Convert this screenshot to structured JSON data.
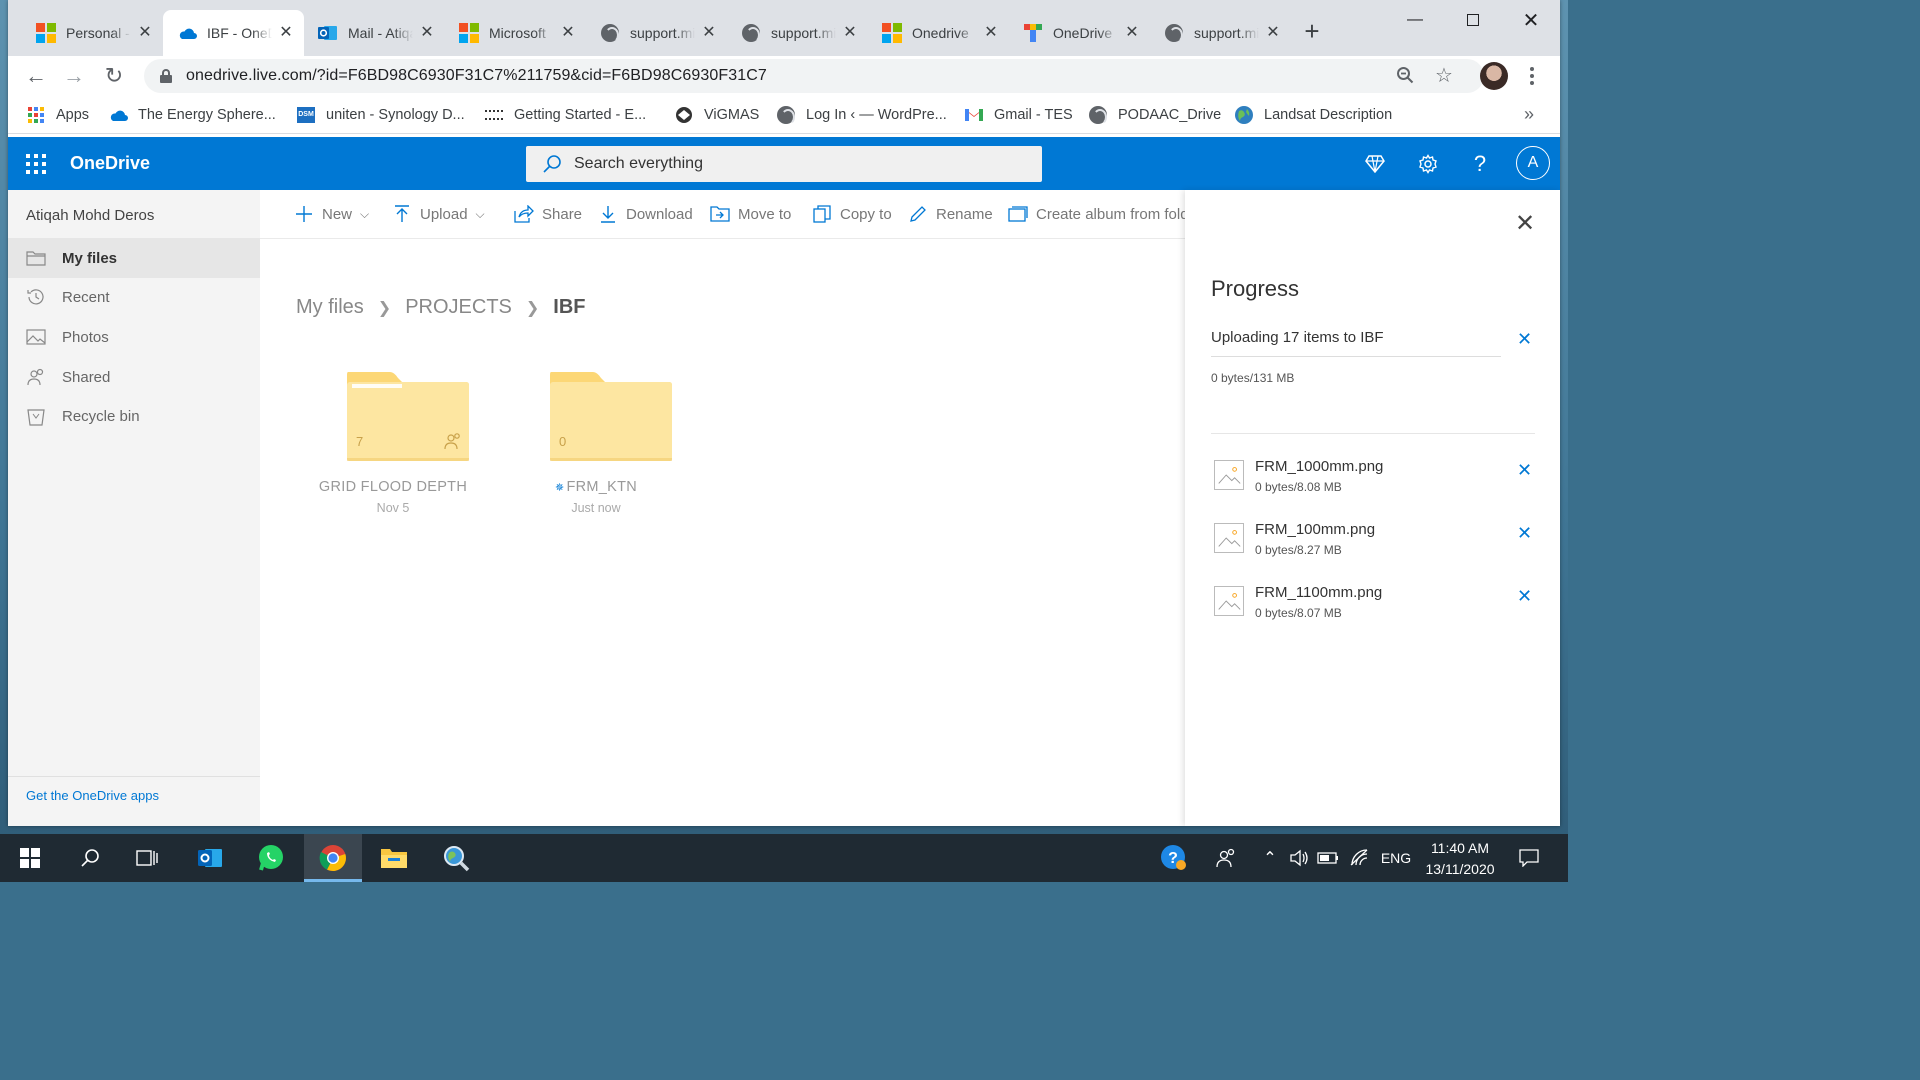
{
  "browser": {
    "tabs": [
      {
        "title": "Personal - OneDrive",
        "favicon": "microsoft-logo",
        "active": false
      },
      {
        "title": "IBF - OneDrive",
        "favicon": "onedrive-cloud-icon",
        "active": true
      },
      {
        "title": "Mail - Atiqah",
        "favicon": "outlook-icon",
        "active": false
      },
      {
        "title": "Microsoft",
        "favicon": "microsoft-logo",
        "active": false
      },
      {
        "title": "support.microsoft.com",
        "favicon": "globe-icon",
        "active": false
      },
      {
        "title": "support.microsoft.com",
        "favicon": "globe-icon",
        "active": false
      },
      {
        "title": "Onedrive",
        "favicon": "microsoft-logo",
        "active": false
      },
      {
        "title": "OneDrive",
        "favicon": "multicolor-t-icon",
        "active": false
      },
      {
        "title": "support.microsoft.com",
        "favicon": "globe-icon",
        "active": false
      }
    ],
    "url": "onedrive.live.com/?id=F6BD98C6930F31C7%211759&cid=F6BD98C6930F31C7",
    "bookmarks": [
      {
        "label": "Apps",
        "icon": "apps-grid-icon"
      },
      {
        "label": "The Energy Sphere...",
        "icon": "cloud-icon"
      },
      {
        "label": "uniten - Synology D...",
        "icon": "dsm-icon"
      },
      {
        "label": "Getting Started - E...",
        "icon": "esri-icon"
      },
      {
        "label": "ViGMAS",
        "icon": "vigmas-icon"
      },
      {
        "label": "Log In ‹ — WordPre...",
        "icon": "globe-icon"
      },
      {
        "label": "Gmail - TES",
        "icon": "gmail-icon"
      },
      {
        "label": "PODAAC_Drive",
        "icon": "globe-icon"
      },
      {
        "label": "Landsat Description",
        "icon": "earth-icon"
      }
    ],
    "bookmarks_more": "»"
  },
  "app": {
    "brand": "OneDrive",
    "search_placeholder": "Search everything",
    "avatar_initial": "A",
    "accent_color": "#0078d4"
  },
  "sidebar": {
    "user_name": "Atiqah Mohd Deros",
    "items": [
      {
        "label": "My files",
        "icon": "folder-icon",
        "selected": true
      },
      {
        "label": "Recent",
        "icon": "history-icon",
        "selected": false
      },
      {
        "label": "Photos",
        "icon": "image-icon",
        "selected": false
      },
      {
        "label": "Shared",
        "icon": "people-icon",
        "selected": false
      },
      {
        "label": "Recycle bin",
        "icon": "recycle-bin-icon",
        "selected": false
      }
    ],
    "get_apps": "Get the OneDrive apps"
  },
  "commands": [
    {
      "label": "New",
      "icon": "plus-icon",
      "dropdown": true
    },
    {
      "label": "Upload",
      "icon": "upload-icon",
      "dropdown": true
    },
    {
      "label": "Share",
      "icon": "share-icon",
      "dropdown": false
    },
    {
      "label": "Download",
      "icon": "download-icon",
      "dropdown": false
    },
    {
      "label": "Move to",
      "icon": "move-icon",
      "dropdown": false
    },
    {
      "label": "Copy to",
      "icon": "copy-icon",
      "dropdown": false
    },
    {
      "label": "Rename",
      "icon": "rename-icon",
      "dropdown": false
    },
    {
      "label": "Create album from folder",
      "icon": "album-icon",
      "dropdown": false
    }
  ],
  "breadcrumb": [
    "My files",
    "PROJECTS",
    "IBF"
  ],
  "folders": [
    {
      "name": "GRID FLOOD DEPTH",
      "count": "7",
      "date": "Nov 5",
      "shared": true
    },
    {
      "name": "FRM_KTN",
      "count": "0",
      "date": "Just now",
      "shared": false
    }
  ],
  "progress": {
    "title": "Progress",
    "upload_label": "Uploading 17 items to IBF",
    "upload_size": "0 bytes/131 MB",
    "files": [
      {
        "name": "FRM_1000mm.png",
        "size": "0 bytes/8.08 MB"
      },
      {
        "name": "FRM_100mm.png",
        "size": "0 bytes/8.27 MB"
      },
      {
        "name": "FRM_1100mm.png",
        "size": "0 bytes/8.07 MB"
      }
    ]
  },
  "taskbar": {
    "language": "ENG",
    "time": "11:40 AM",
    "date": "13/11/2020"
  }
}
